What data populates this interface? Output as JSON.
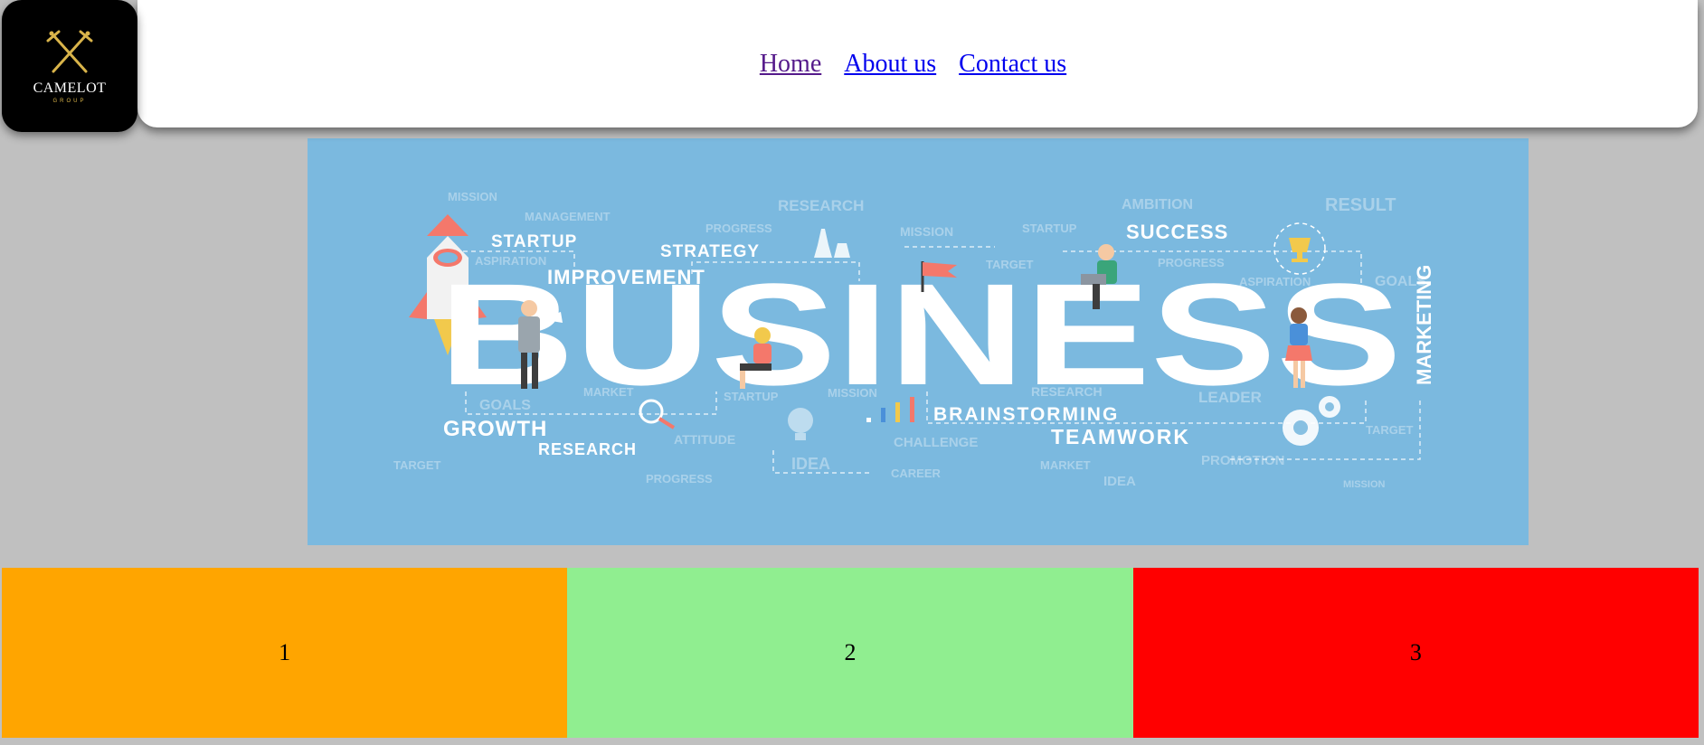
{
  "logo": {
    "name": "CAMELOT",
    "sub": "GROUP"
  },
  "nav": {
    "items": [
      {
        "label": "Home",
        "visited": true
      },
      {
        "label": "About us",
        "visited": false
      },
      {
        "label": "Contact us",
        "visited": false
      }
    ]
  },
  "hero": {
    "headline": "BUSINESS",
    "side_word": "MARKETING",
    "bold_words": [
      "STARTUP",
      "STRATEGY",
      "IMPROVEMENT",
      "SUCCESS",
      "GROWTH",
      "RESEARCH",
      "BRAINSTORMING",
      "TEAMWORK"
    ],
    "faint_words": [
      "MISSION",
      "MANAGEMENT",
      "RESEARCH",
      "PROGRESS",
      "AMBITION",
      "RESULT",
      "MISSION",
      "STARTUP",
      "ASPIRATION",
      "TARGET",
      "PROGRESS",
      "ASPIRATION",
      "GOALS",
      "GOALS",
      "MARKET",
      "STARTUP",
      "MISSION",
      "RESEARCH",
      "LEADER",
      "ATTITUDE",
      "CHALLENGE",
      "TARGET",
      "TARGET",
      "IDEA",
      "CAREER",
      "MARKET",
      "PROMOTION",
      "PROGRESS",
      "IDEA",
      "MISSION"
    ],
    "colors": {
      "background": "#7bb9df",
      "text": "#ffffff"
    }
  },
  "boxes": [
    {
      "label": "1",
      "color": "#ffa500"
    },
    {
      "label": "2",
      "color": "#90ee90"
    },
    {
      "label": "3",
      "color": "#ff0000"
    }
  ]
}
